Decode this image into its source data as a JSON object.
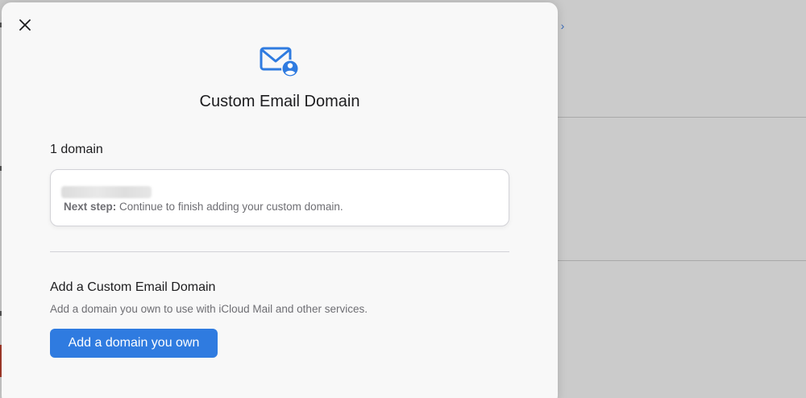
{
  "background": {
    "link_text": "e ›"
  },
  "modal": {
    "title": "Custom Email Domain",
    "header_icon": "mail-person-icon",
    "close_icon": "close-icon",
    "domains_count_label": "1 domain",
    "domain_card": {
      "domain_name": "example.com",
      "next_step_label": "Next step:",
      "next_step_text": " Continue to finish adding your custom domain."
    },
    "add_section": {
      "title": "Add a Custom Email Domain",
      "description": "Add a domain you own to use with iCloud Mail and other services.",
      "button_label": "Add a domain you own"
    }
  },
  "colors": {
    "accent": "#2f7be0",
    "modal_bg": "#f8f8f8",
    "overlay_bg": "#cbcbcb",
    "secondary_text": "#6e6e73"
  }
}
